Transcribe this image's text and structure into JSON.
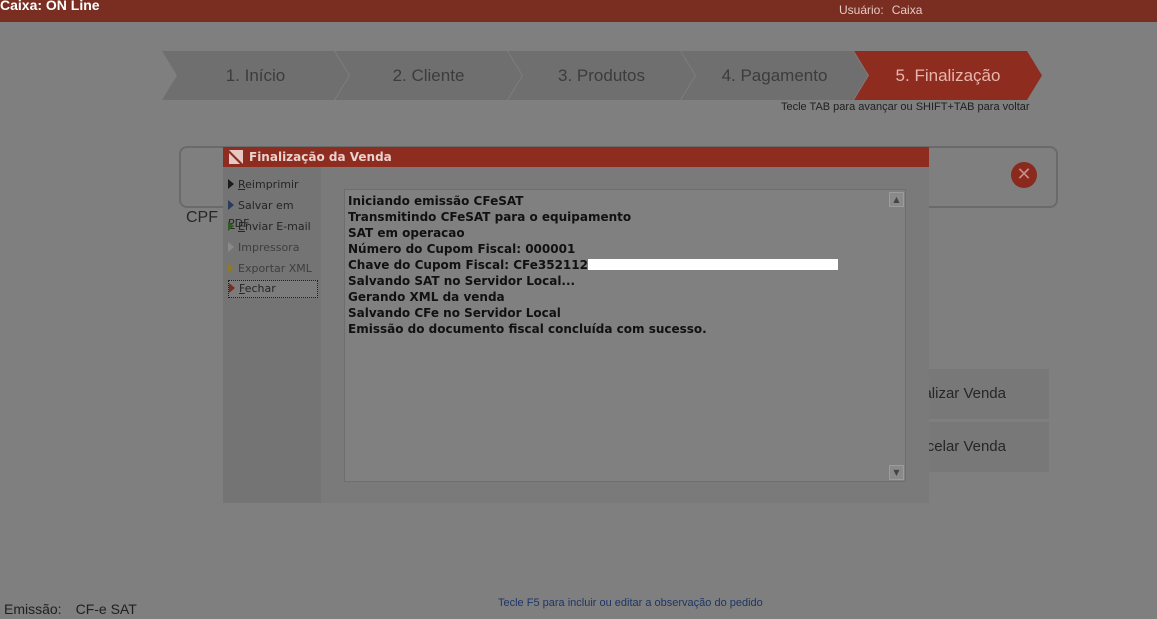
{
  "app": {
    "title": "Caixa: ON Line",
    "user_label": "Usuário:",
    "user_name": "Caixa"
  },
  "steps": [
    {
      "label": "1. Início"
    },
    {
      "label": "2. Cliente"
    },
    {
      "label": "3. Produtos"
    },
    {
      "label": "4. Pagamento"
    },
    {
      "label": "5. Finalização",
      "active": true
    }
  ],
  "nav_hint": "Tecle TAB para avançar ou SHIFT+TAB para voltar",
  "background": {
    "cpf_label": "CPF",
    "finalize_partial": "alizar Venda",
    "cancel_partial": "ncelar Venda"
  },
  "footer": {
    "emissao_label": "Emissão:",
    "emissao_value": "CF-e SAT",
    "hint": "Tecle F5 para incluir ou editar a observação do pedido"
  },
  "modal": {
    "title": "Finalização da Venda",
    "menu": [
      {
        "label": "Reimprimir",
        "mnemonic": "R",
        "rest": "eimprimir"
      },
      {
        "label": "Salvar em PDF",
        "mnemonic": "P",
        "pre": "Salvar em ",
        "rest": "DF"
      },
      {
        "label": "Enviar E-mail",
        "mnemonic": "E",
        "rest": "nviar E-mail"
      },
      {
        "label": "Impressora"
      },
      {
        "label": "Exportar XML"
      },
      {
        "label": "Fechar",
        "mnemonic": "F",
        "rest": "echar"
      }
    ],
    "log": [
      "Iniciando emissão CFeSAT",
      "Transmitindo CFeSAT para o equipamento",
      "SAT em operacao",
      "Número do Cupom Fiscal: 000001",
      "Chave do Cupom Fiscal: CFe352112",
      "Salvando SAT no Servidor Local...",
      "Gerando XML da venda",
      "Salvando CFe no Servidor Local",
      "Emissão do documento fiscal concluída com sucesso."
    ]
  },
  "colors": {
    "accent": "#c0392b",
    "overlay": "#7f7f7f"
  }
}
